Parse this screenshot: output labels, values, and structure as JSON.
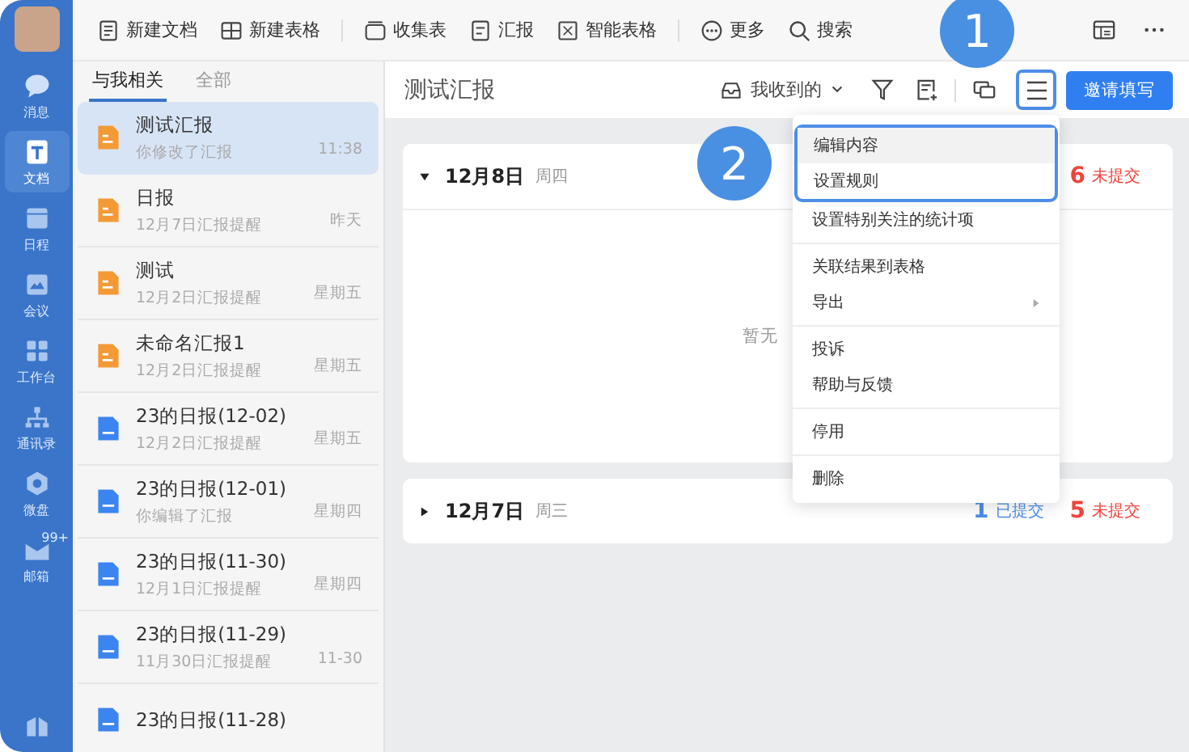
{
  "sidebar": {
    "items": [
      {
        "label": "消息",
        "selected": false
      },
      {
        "label": "文档",
        "selected": true
      },
      {
        "label": "日程",
        "selected": false
      },
      {
        "label": "会议",
        "selected": false
      },
      {
        "label": "工作台",
        "selected": false
      },
      {
        "label": "通讯录",
        "selected": false
      },
      {
        "label": "微盘",
        "selected": false
      },
      {
        "label": "邮箱",
        "selected": false,
        "badge": "99+"
      }
    ]
  },
  "toolbar": {
    "items": [
      {
        "label": "新建文档"
      },
      {
        "label": "新建表格"
      },
      {
        "label": "收集表"
      },
      {
        "label": "汇报"
      },
      {
        "label": "智能表格"
      },
      {
        "label": "更多"
      },
      {
        "label": "搜索"
      }
    ]
  },
  "list": {
    "tabs": [
      {
        "label": "与我相关",
        "selected": true
      },
      {
        "label": "全部",
        "selected": false
      }
    ],
    "items": [
      {
        "kind": "report",
        "title": "测试汇报",
        "subtitle": "你修改了汇报",
        "time": "11:38",
        "selected": true
      },
      {
        "kind": "report",
        "title": "日报",
        "subtitle": "12月7日汇报提醒",
        "time": "昨天",
        "selected": false
      },
      {
        "kind": "report",
        "title": "测试",
        "subtitle": "12月2日汇报提醒",
        "time": "星期五",
        "selected": false
      },
      {
        "kind": "report",
        "title": "未命名汇报1",
        "subtitle": "12月2日汇报提醒",
        "time": "星期五",
        "selected": false
      },
      {
        "kind": "doc",
        "title": "23的日报(12-02)",
        "subtitle": "12月2日汇报提醒",
        "time": "星期五",
        "selected": false
      },
      {
        "kind": "doc",
        "title": "23的日报(12-01)",
        "subtitle": "你编辑了汇报",
        "time": "星期四",
        "selected": false
      },
      {
        "kind": "doc",
        "title": "23的日报(11-30)",
        "subtitle": "12月1日汇报提醒",
        "time": "星期四",
        "selected": false
      },
      {
        "kind": "doc",
        "title": "23的日报(11-29)",
        "subtitle": "11月30日汇报提醒",
        "time": "11-30",
        "selected": false
      },
      {
        "kind": "doc",
        "title": "23的日报(11-28)",
        "selected": false
      }
    ]
  },
  "main": {
    "title": "测试汇报",
    "filter": "我收到的",
    "invite_button": "邀请填写",
    "days": [
      {
        "date": "12月8日",
        "weekday": "周四",
        "expanded": true,
        "unsubmitted_count": "6",
        "unsubmitted_label": "未提交",
        "empty_text": "暂无"
      },
      {
        "date": "12月7日",
        "weekday": "周三",
        "expanded": false,
        "submitted_count": "1",
        "submitted_label": "已提交",
        "unsubmitted_count": "5",
        "unsubmitted_label": "未提交"
      }
    ]
  },
  "menu": {
    "groups": [
      [
        {
          "label": "编辑内容",
          "selected": true
        },
        {
          "label": "设置规则",
          "selected": false
        },
        {
          "label": "设置特别关注的统计项",
          "selected": false
        }
      ],
      [
        {
          "label": "关联结果到表格",
          "selected": false
        },
        {
          "label": "导出",
          "selected": false,
          "submenu": true
        }
      ],
      [
        {
          "label": "投诉",
          "selected": false
        },
        {
          "label": "帮助与反馈",
          "selected": false
        }
      ],
      [
        {
          "label": "停用",
          "selected": false
        }
      ],
      [
        {
          "label": "删除",
          "selected": false
        }
      ]
    ]
  },
  "callouts": [
    "1",
    "2"
  ]
}
